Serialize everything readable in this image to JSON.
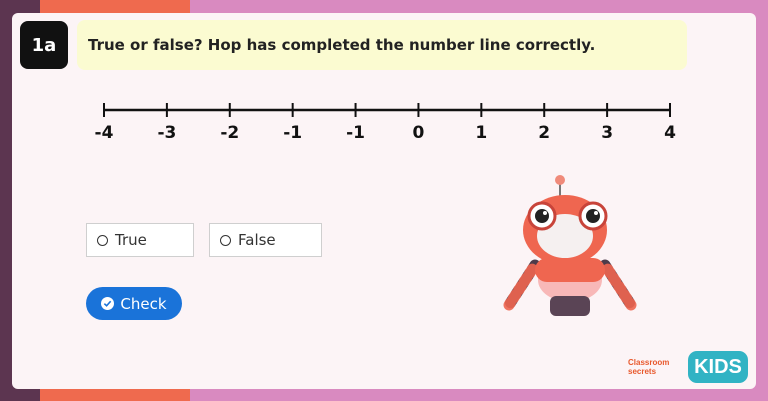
{
  "question": {
    "badge": "1a",
    "text": "True or false? Hop has completed the number line correctly."
  },
  "number_line": {
    "labels": [
      "-4",
      "-3",
      "-2",
      "-1",
      "-1",
      "0",
      "1",
      "2",
      "3",
      "4"
    ]
  },
  "options": {
    "true_label": "True",
    "false_label": "False"
  },
  "check_button": {
    "label": "Check"
  },
  "logo": {
    "line1": "Classroom",
    "line2": "secrets",
    "kids": "KIDS"
  },
  "colors": {
    "accent": "#1a73d9",
    "question_bg": "#fbfbd1",
    "robot": "#ef6650"
  }
}
